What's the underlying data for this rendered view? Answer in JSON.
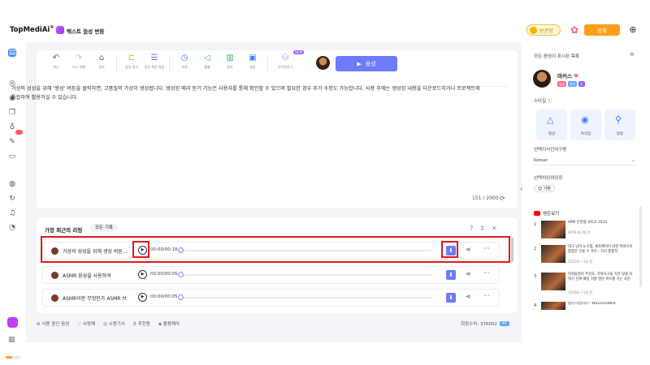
{
  "header": {
    "brand": "TopMediAi",
    "brand_sup": "®",
    "product_title": "텍스트 음성 변환",
    "points_label": "보관함",
    "premium_label": "정회"
  },
  "toolbar": {
    "tools": [
      {
        "label": "취소",
        "icon": "undo-icon"
      },
      {
        "label": "다시 실행",
        "icon": "redo-icon"
      },
      {
        "label": "정리",
        "icon": "broom-icon"
      },
      {
        "label": "삽입 중지",
        "icon": "pause-insert-icon"
      },
      {
        "label": "음성 화음 발음",
        "icon": "phoneme-icon"
      },
      {
        "label": "속력",
        "icon": "speed-icon"
      },
      {
        "label": "볼륨",
        "icon": "volume-icon"
      },
      {
        "label": "음악",
        "icon": "music-icon"
      },
      {
        "label": "발음",
        "icon": "pronunciation-icon"
      },
      {
        "label": "다이얼로그",
        "icon": "dialog-icon"
      }
    ],
    "new_tag": "NEW",
    "generate_label": "음성"
  },
  "editor": {
    "text": "가상의 성성을 위해 '생성' 버튼을 클릭하면, 고품질의 가상이 생성됩니다. 생성된 메리 듣기 기능은 사용자를 통해 확인할 수 있으며 필요한 경우 추가 수정도 가능합니다. 사용 후에는 생성된 내용을 다운로드하거나 프로젝트에 통합하여 활용하실 수 있습니다.",
    "counter": "151 / 2000"
  },
  "records": {
    "title": "가장 최근의 리핑",
    "all_label": "모든 기록",
    "rows": [
      {
        "text": "가상의 성성을 위해 생성 버튼...",
        "time": "00:00/00:18"
      },
      {
        "text": "ASMR 음성을 사용하여",
        "time": "00:00/00:05"
      },
      {
        "text": "ASMR이란 무엇인가 ASMR 브",
        "time": "00:00/00:05"
      }
    ]
  },
  "bottom_links": [
    "사용 중인 음성",
    "사랑해",
    "시용기사",
    "추천용",
    "활용해라"
  ],
  "credits": {
    "label": "회원수치: 376002",
    "chip": "45"
  },
  "right_panel": {
    "header": "모든 음성이 표시된 목록",
    "voice_name": "마커스",
    "tags": [
      "남성",
      "중년",
      "중"
    ],
    "style_label": "스타일",
    "styles": [
      {
        "label": "정상",
        "icon": "triangle-icon"
      },
      {
        "label": "속삭임",
        "icon": "whisper-icon"
      },
      {
        "label": "방송",
        "icon": "broadcast-icon"
      }
    ],
    "lang_label": "선택지식인어구동",
    "lang_value": "Korean",
    "emotion_label": "선택치잉외잉징",
    "emotion_chip": "기본",
    "yt_label": "영은보기",
    "videos": [
      {
        "num": "1",
        "title": "AMP 신현생 사이코 2024",
        "meta": "4479 회 3일 전"
      },
      {
        "num": "2",
        "title": "대국 남자 눈꾸됨, 세포베이어 대한 여성으로 통통한 인물 수 하다 - 가되 통통적",
        "meta": "2547회 • 1일 전"
      },
      {
        "num": "3",
        "title": "피죄들필러 주진호, 가락사고들 지치 않을 지 뭐가 진짜 패용 지원 영산 파트를 가는 사진",
        "meta": "1554회 • 1일 전"
      },
      {
        "num": "4",
        "title": "빌리 아일리시 - WILDFLOWER",
        "meta": ""
      }
    ]
  },
  "colors": {
    "accent": "#6d7bff",
    "premium": "#ff9f1c",
    "highlight": "#e0191a"
  }
}
